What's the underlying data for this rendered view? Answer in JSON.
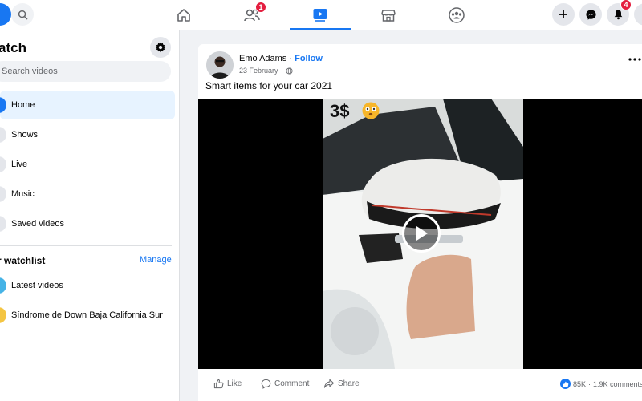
{
  "topbar": {
    "friends_badge": "1",
    "notifications_badge": "4"
  },
  "sidebar": {
    "title": "atch",
    "search_placeholder": "Search videos",
    "items": [
      {
        "label": "Home"
      },
      {
        "label": "Shows"
      },
      {
        "label": "Live"
      },
      {
        "label": "Music"
      },
      {
        "label": "Saved videos"
      }
    ],
    "watchlist_heading": "r watchlist",
    "manage_label": "Manage",
    "watchlist_items": [
      {
        "label": "Latest videos"
      },
      {
        "label": "Síndrome de Down Baja California Sur"
      }
    ]
  },
  "post": {
    "author": "Emo Adams",
    "separator": " · ",
    "follow_label": "Follow",
    "date": "23 February",
    "date_separator": "·",
    "text": "Smart items for your car 2021",
    "video_overlay_text": "3$",
    "actions": {
      "like": "Like",
      "comment": "Comment",
      "share": "Share"
    },
    "reaction_count": "85K",
    "stats_separator": "·",
    "comment_count": "1.9K comments"
  },
  "colors": {
    "brand": "#1877f2",
    "badge": "#e41e3f"
  }
}
